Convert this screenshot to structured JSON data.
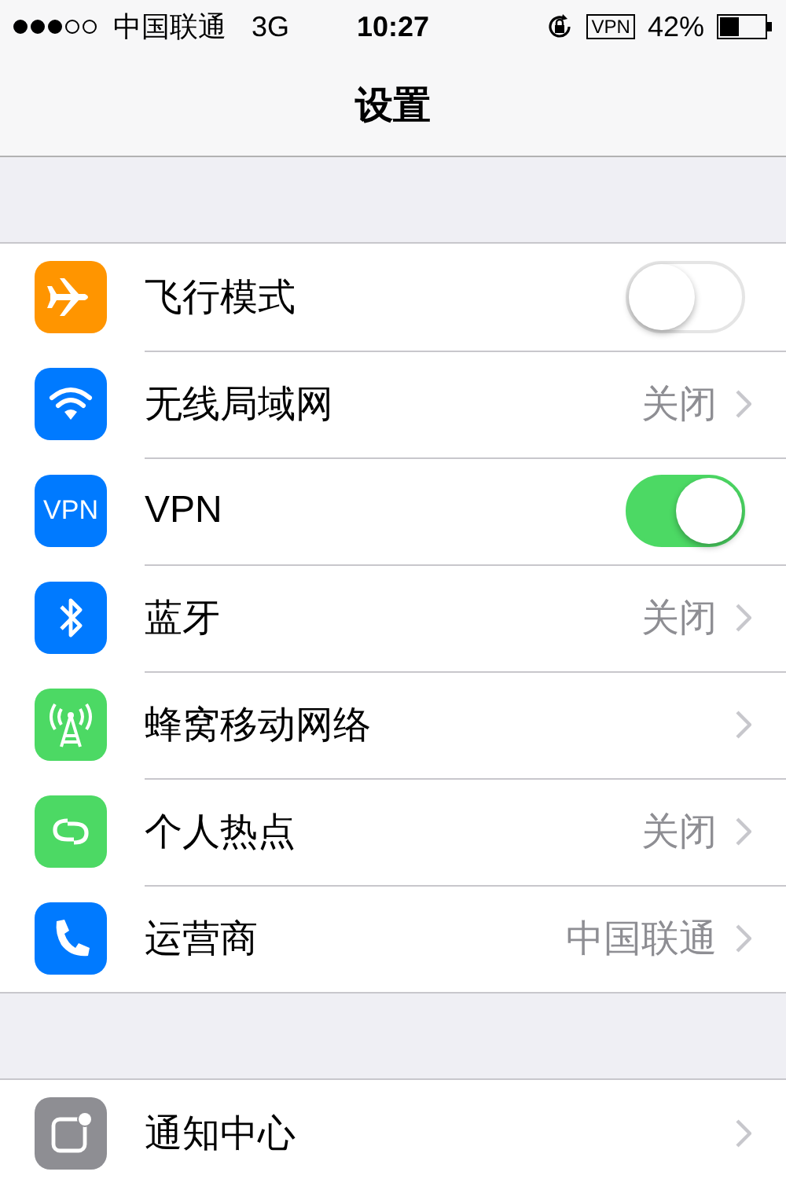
{
  "status_bar": {
    "carrier": "中国联通",
    "network": "3G",
    "time": "10:27",
    "vpn": "VPN",
    "battery": "42%"
  },
  "nav": {
    "title": "设置"
  },
  "groups": [
    {
      "rows": [
        {
          "label": "飞行模式",
          "color": "#ff9500",
          "kind": "toggle",
          "on": false
        },
        {
          "label": "无线局域网",
          "color": "#007aff",
          "kind": "link",
          "value": "关闭"
        },
        {
          "label": "VPN",
          "icon_text": "VPN",
          "color": "#007aff",
          "kind": "toggle",
          "on": true
        },
        {
          "label": "蓝牙",
          "color": "#007aff",
          "kind": "link",
          "value": "关闭"
        },
        {
          "label": "蜂窝移动网络",
          "color": "#4cd964",
          "kind": "link"
        },
        {
          "label": "个人热点",
          "color": "#4cd964",
          "kind": "link",
          "value": "关闭"
        },
        {
          "label": "运营商",
          "color": "#007aff",
          "kind": "link",
          "value": "中国联通"
        }
      ]
    },
    {
      "rows": [
        {
          "label": "通知中心",
          "color": "#8e8e93",
          "kind": "link"
        }
      ]
    }
  ]
}
